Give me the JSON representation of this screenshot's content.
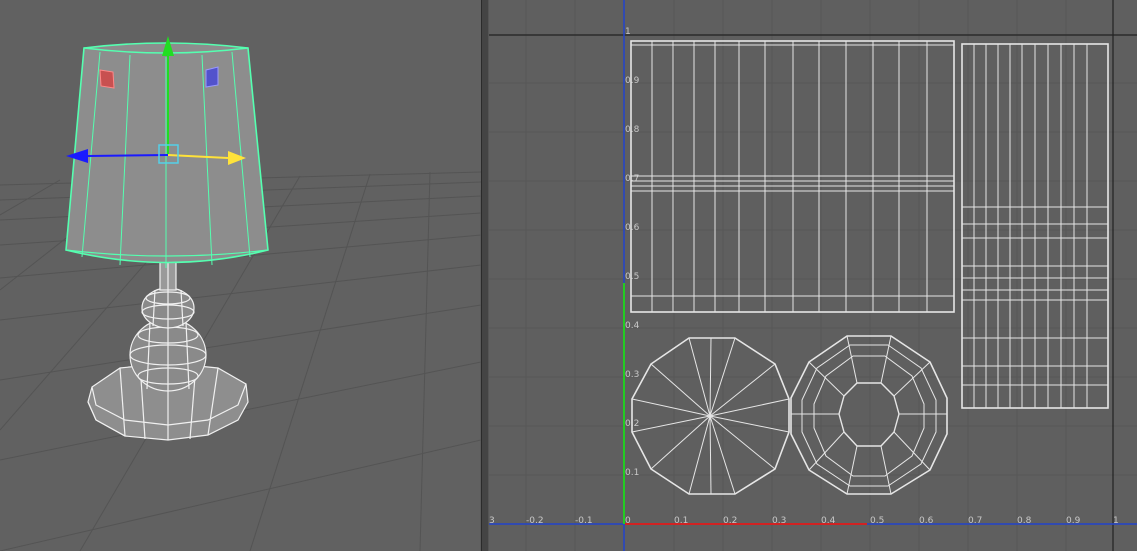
{
  "viewports": {
    "perspective": {
      "object": "lamp-model",
      "gizmo": "move-manipulator"
    },
    "uv_editor": {
      "u_ticks": [
        "3",
        "-0.2",
        "-0.1",
        "0",
        "0.1",
        "0.2",
        "0.3",
        "0.4",
        "0.5",
        "0.6",
        "0.7",
        "0.8",
        "0.9",
        "1"
      ],
      "v_ticks": [
        "1",
        "0.9",
        "0.8",
        "0.7",
        "0.6",
        "0.5",
        "0.4",
        "0.3",
        "0.2",
        "0.1"
      ]
    }
  },
  "colors": {
    "viewport_bg": "#616161",
    "grid": "#575757",
    "wire": "#e6e6e6",
    "selection_wire": "#55ffb0",
    "axis_x": "#ffe23a",
    "axis_y": "#22dd22",
    "axis_z": "#1a1aff",
    "uv_axis_u": "#d12222",
    "uv_axis_v": "#22cc22",
    "uv_axis_blue": "#2244cc"
  },
  "icons": [
    "move-arrow-y",
    "move-arrow-x",
    "move-arrow-z",
    "plane-handle-red",
    "plane-handle-blue",
    "center-handle"
  ]
}
